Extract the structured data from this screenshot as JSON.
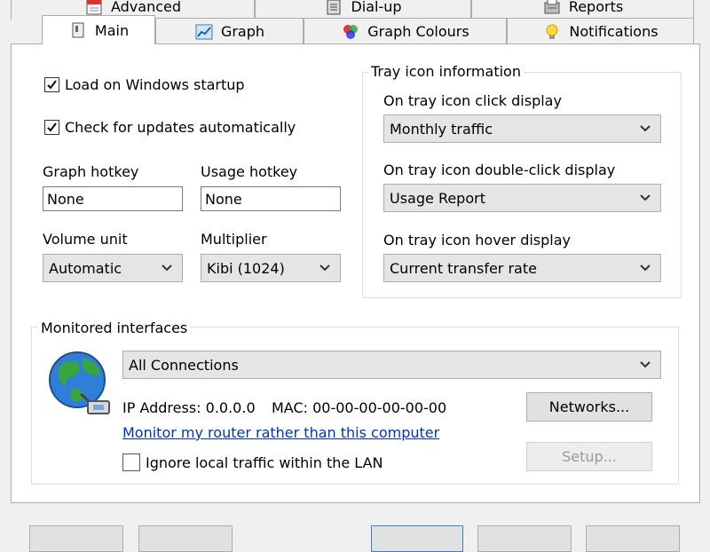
{
  "tabs_back": [
    {
      "label": "Advanced",
      "icon": "calendar-icon"
    },
    {
      "label": "Dial-up",
      "icon": "phone-book-icon"
    },
    {
      "label": "Reports",
      "icon": "report-icon"
    }
  ],
  "tabs_front": [
    {
      "label": "Main",
      "icon": "main-page-icon",
      "active": true
    },
    {
      "label": "Graph",
      "icon": "graph-icon"
    },
    {
      "label": "Graph Colours",
      "icon": "colours-icon"
    },
    {
      "label": "Notifications",
      "icon": "lightbulb-icon"
    }
  ],
  "main": {
    "load_on_startup": {
      "label": "Load on Windows startup",
      "checked": true
    },
    "check_updates": {
      "label": "Check for updates automatically",
      "checked": true
    },
    "graph_hotkey": {
      "label": "Graph hotkey",
      "value": "None"
    },
    "usage_hotkey": {
      "label": "Usage hotkey",
      "value": "None"
    },
    "volume_unit": {
      "label": "Volume unit",
      "value": "Automatic"
    },
    "multiplier": {
      "label": "Multiplier",
      "value": "Kibi (1024)"
    }
  },
  "tray": {
    "title": "Tray icon information",
    "click": {
      "label": "On tray icon click display",
      "value": "Monthly traffic"
    },
    "double_click": {
      "label": "On tray icon double-click display",
      "value": "Usage Report"
    },
    "hover": {
      "label": "On tray icon hover display",
      "value": "Current transfer rate"
    }
  },
  "interfaces": {
    "title": "Monitored interfaces",
    "selected": "All Connections",
    "ip_address": "IP Address: 0.0.0.0",
    "mac": "MAC: 00-00-00-00-00-00",
    "networks_button": "Networks...",
    "router_link": "Monitor my router rather than this computer",
    "ignore_lan": {
      "label": "Ignore local traffic within the LAN",
      "checked": false
    },
    "setup_button": "Setup..."
  },
  "colors": {
    "panel_bg": "#ffffff",
    "window_bg": "#f0f0f0",
    "link": "#0033cc",
    "border": "#adadad"
  }
}
